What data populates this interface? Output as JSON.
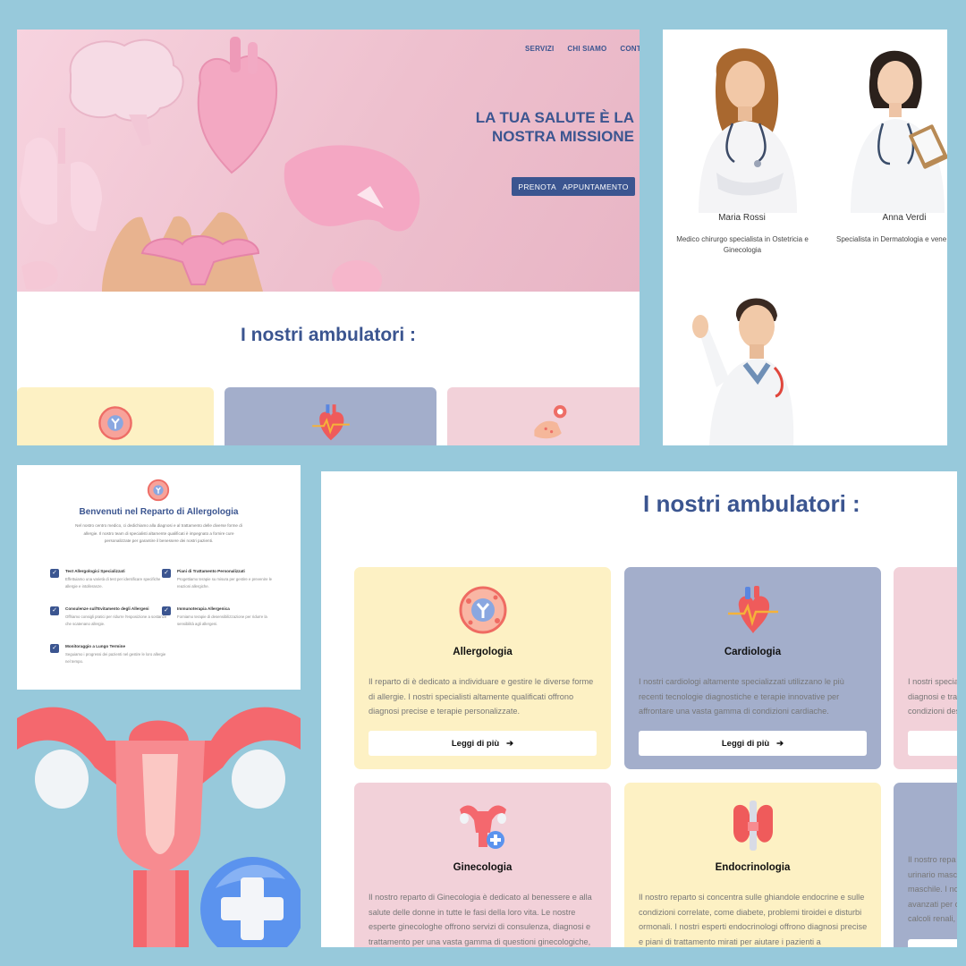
{
  "hero": {
    "nav": [
      "SERVIZI",
      "CHI SIAMO",
      "CONTA"
    ],
    "title_line1": "LA TUA SALUTE È LA",
    "title_line2": "NOSTRA MISSIONE",
    "cta": "PRENOTA   APPUNTAMENTO"
  },
  "preview": {
    "section_title": "I nostri ambulatori :"
  },
  "doctors": [
    {
      "name": "Maria Rossi",
      "role": "Medico chirurgo specialista in Ostetricia e Ginecologia"
    },
    {
      "name": "Anna Verdi",
      "role": "Specialista in Dermatologia e vene"
    }
  ],
  "allergy": {
    "title": "Benvenuti nel Reparto di Allergologia",
    "intro": "Nel nostro centro medico, ci dedichiamo alla diagnosi e al trattamento delle diverse forme di allergie. Il nostro team di specialisti altamente qualificati è impegnato a fornire cure personalizzate per garantire il benessere dei nostri pazienti.",
    "features": [
      {
        "title": "Test Allergologici Specializzati",
        "desc": "Effettuiamo una varietà di test per identificare specifiche allergie e intolleranze."
      },
      {
        "title": "Piani di Trattamento Personalizzati",
        "desc": "Progettiamo terapie su misura per gestire e prevenire le reazioni allergiche."
      },
      {
        "title": "Consulenze sull'Evitamento degli Allergeni",
        "desc": "Offriamo consigli pratici per ridurre l'esposizione a sostanze che scatenano allergie."
      },
      {
        "title": "Immunoterapia Allergenica",
        "desc": "Forniamo terapie di desensibilizzazione per ridurre la sensibilità agli allergeni."
      },
      {
        "title": "Monitoraggio a Lungo Termine",
        "desc": "Seguiamo i progressi dei pazienti nel gestire le loro allergie nel tempo."
      }
    ]
  },
  "ambulatori": {
    "title": "I nostri ambulatori :",
    "cards": [
      {
        "icon": "allergy-cell-icon",
        "title": "Allergologia",
        "desc": "Il reparto di è dedicato a individuare e gestire le diverse forme di allergie. I nostri specialisti altamente qualificati offrono diagnosi precise e terapie personalizzate.",
        "button": "Leggi di più"
      },
      {
        "icon": "heart-icon",
        "title": "Cardiologia",
        "desc": "I nostri cardiologi altamente specializzati utilizzano le più recenti tecnologie diagnostiche e terapie innovative per affrontare una vasta gamma di condizioni cardiache.",
        "button": "Leggi di più"
      },
      {
        "icon": "skin-icon",
        "title": "",
        "desc": "I nostri specia diagnosi e tra condizioni des",
        "button": ""
      },
      {
        "icon": "uterus-plus-icon",
        "title": "Ginecologia",
        "desc": "Il nostro reparto di Ginecologia è dedicato al benessere e alla salute delle donne in tutte le fasi della loro vita. Le nostre esperte ginecologhe offrono servizi di consulenza, diagnosi e trattamento per una vasta gamma di questioni ginecologiche,",
        "button": ""
      },
      {
        "icon": "thyroid-icon",
        "title": "Endocrinologia",
        "desc": "Il nostro reparto si concentra sulle ghiandole endocrine e sulle condizioni correlate, come diabete, problemi tiroidei e disturbi ormonali. I nostri esperti endocrinologi offrono diagnosi precise e piani di trattamento mirati per aiutare i pazienti a",
        "button": ""
      },
      {
        "icon": "kidney-icon",
        "title": "",
        "desc": "Il nostro repa urinario masc maschile. I no avanzati per c calcoli renali,",
        "button": ""
      }
    ]
  },
  "colors": {
    "primary": "#3b5590",
    "background": "#97c9db",
    "yellow": "#fdf1c4",
    "blue": "#a3aecb",
    "pink": "#f2d1d9"
  }
}
